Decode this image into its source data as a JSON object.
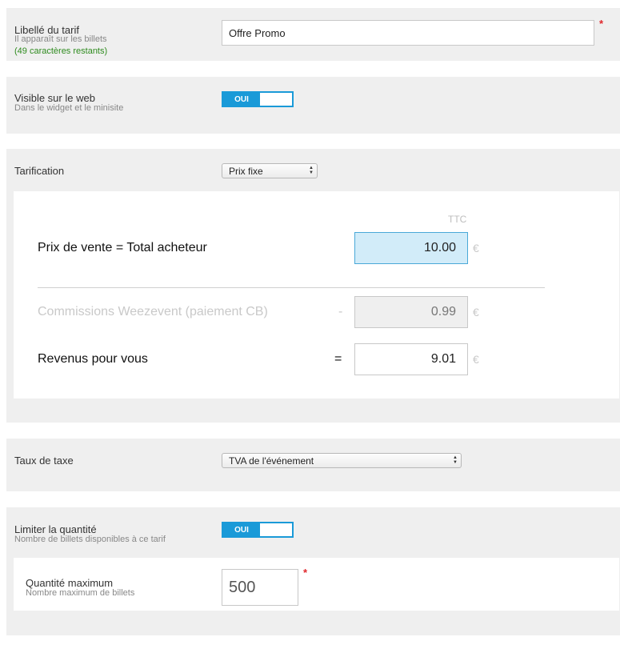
{
  "tariff_label": {
    "title": "Libellé du tarif",
    "hint": "Il apparaît sur les billets",
    "remaining": "(49 caractères restants)",
    "value": "Offre Promo",
    "required_mark": "*"
  },
  "web_visibility": {
    "title": "Visible sur le web",
    "hint": "Dans le widget et le minisite",
    "toggle_label": "OUI"
  },
  "pricing": {
    "title": "Tarification",
    "selected": "Prix fixe",
    "ttc_header": "TTC",
    "sale_price_label": "Prix de vente = Total acheteur",
    "sale_price_value": "10.00",
    "commission_label": "Commissions Weezevent (paiement CB)",
    "commission_operator": "-",
    "commission_value": "0.99",
    "revenue_label": "Revenus pour vous",
    "revenue_operator": "=",
    "revenue_value": "9.01",
    "currency": "€"
  },
  "tax": {
    "title": "Taux de taxe",
    "selected": "TVA de l'événement"
  },
  "quantity": {
    "title": "Limiter la quantité",
    "hint": "Nombre de billets disponibles à ce tarif",
    "toggle_label": "OUI",
    "max_title": "Quantité maximum",
    "max_hint": "Nombre maximum de billets",
    "max_value": "500",
    "required_mark": "*"
  },
  "colors": {
    "accent": "#1a9ad8",
    "required": "#e0262b",
    "hint_green": "#2e8b1e",
    "active_field": "#d2ecf9",
    "panel_bg": "#efefef"
  }
}
